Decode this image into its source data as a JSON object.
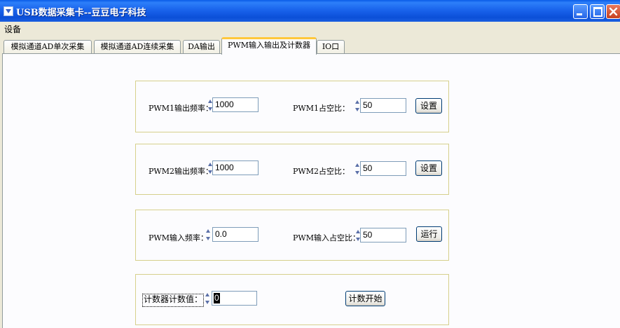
{
  "window": {
    "title": "USB数据采集卡--豆豆电子科技"
  },
  "menu": {
    "items": [
      "设备"
    ]
  },
  "tabs": [
    {
      "label": "模拟通道AD单次采集",
      "active": false
    },
    {
      "label": "模拟通道AD连续采集",
      "active": false
    },
    {
      "label": "DA输出",
      "active": false
    },
    {
      "label": "PWM输入输出及计数器",
      "active": true
    },
    {
      "label": "IO口",
      "active": false
    }
  ],
  "pwm1": {
    "freq_label": "PWM1输出频率：",
    "freq_value": "1000",
    "duty_label": "PWM1占空比：",
    "duty_value": "50",
    "button": "设置"
  },
  "pwm2": {
    "freq_label": "PWM2输出频率：",
    "freq_value": "1000",
    "duty_label": "PWM2占空比：",
    "duty_value": "50",
    "button": "设置"
  },
  "pwm_input": {
    "freq_label": "PWM输入频率：",
    "freq_value": "0.0",
    "duty_label": "PWM输入占空比：",
    "duty_value": "50",
    "button": "运行"
  },
  "counter": {
    "label": "计数器计数值：",
    "value": "0",
    "button": "计数开始"
  }
}
